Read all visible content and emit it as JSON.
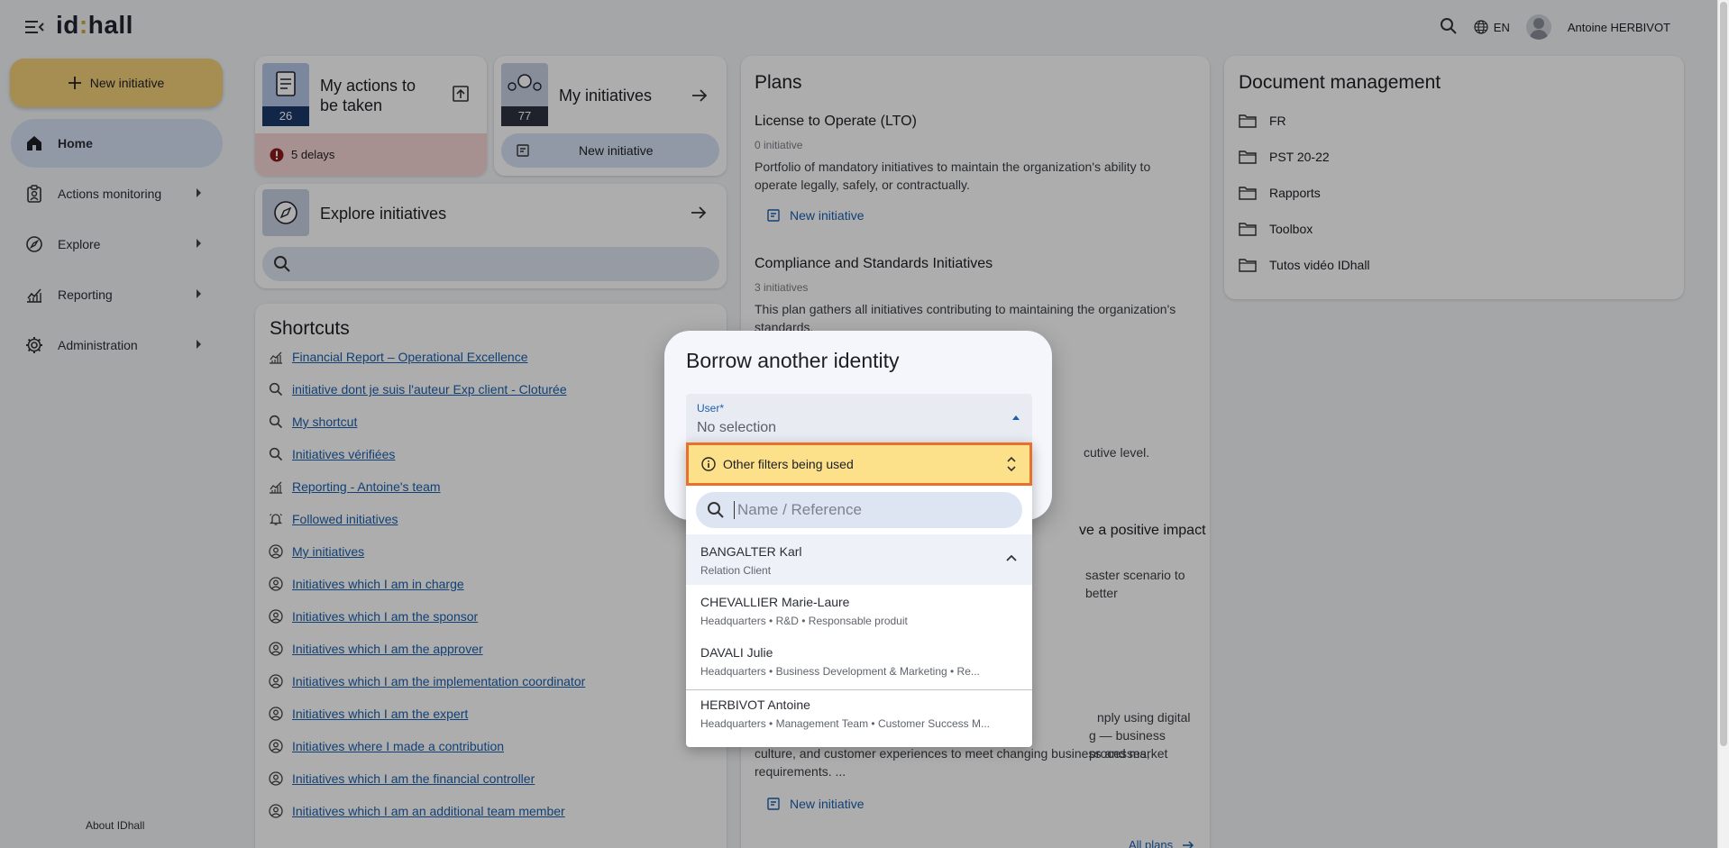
{
  "app": {
    "logo_text_1": "id",
    "logo_dot": ":",
    "logo_text_2": "hall",
    "language": "EN",
    "user_name": "Antoine HERBIVOT"
  },
  "sidebar": {
    "new_initiative_label": "New initiative",
    "items": [
      {
        "label": "Home",
        "icon": "home-icon",
        "active": true
      },
      {
        "label": "Actions monitoring",
        "icon": "clipboard-user-icon"
      },
      {
        "label": "Explore",
        "icon": "compass-icon"
      },
      {
        "label": "Reporting",
        "icon": "chart-icon"
      },
      {
        "label": "Administration",
        "icon": "gear-icon"
      }
    ],
    "about_label": "About IDhall"
  },
  "tiles": {
    "actions": {
      "title_line1": "My actions to",
      "title_line2": "be taken",
      "count": "26",
      "delays": "5 delays"
    },
    "initiatives": {
      "title": "My initiatives",
      "count": "77",
      "button": "New initiative"
    },
    "explore": {
      "title": "Explore initiatives"
    }
  },
  "shortcuts": {
    "title": "Shortcuts",
    "items": [
      {
        "label": "Financial Report – Operational Excellence",
        "icon": "chart-icon"
      },
      {
        "label": "initiative dont je suis l'auteur Exp client - Cloturée",
        "icon": "search-icon"
      },
      {
        "label": "My shortcut",
        "icon": "search-icon"
      },
      {
        "label": "Initiatives vérifiées",
        "icon": "search-icon"
      },
      {
        "label": "Reporting - Antoine's team",
        "icon": "chart-icon"
      },
      {
        "label": "Followed initiatives",
        "icon": "bell-icon"
      },
      {
        "label": "My initiatives",
        "icon": "user-circle-icon"
      },
      {
        "label": "Initiatives which I am in charge",
        "icon": "user-circle-icon"
      },
      {
        "label": "Initiatives which I am the sponsor",
        "icon": "user-circle-icon"
      },
      {
        "label": "Initiatives which I am the approver",
        "icon": "user-circle-icon"
      },
      {
        "label": "Initiatives which I am the implementation coordinator",
        "icon": "user-circle-icon"
      },
      {
        "label": "Initiatives which I am the expert",
        "icon": "user-circle-icon"
      },
      {
        "label": "Initiatives where I made a contribution",
        "icon": "user-circle-icon"
      },
      {
        "label": "Initiatives which I am the financial controller",
        "icon": "user-circle-icon"
      },
      {
        "label": "Initiatives which I am an additional team member",
        "icon": "user-circle-icon"
      }
    ]
  },
  "plans": {
    "title": "Plans",
    "p1": {
      "title": "License to Operate (LTO)",
      "count": "0 initiative",
      "desc": "Portfolio of mandatory initiatives to maintain the organization's ability to operate legally, safely, or contractually.",
      "link": "New initiative"
    },
    "p2": {
      "title": "Compliance and Standards Initiatives",
      "count": "3 initiatives",
      "desc": "This plan gathers all initiatives contributing to maintaining the organization's standards."
    },
    "p3_fragment": "cutive level.",
    "p4_title_fragment": "ve a positive impact",
    "p4_desc_fragment": "saster scenario to better",
    "p5": {
      "line1": "nply using digital",
      "line2": "g — business processes,",
      "line3": "culture, and customer experiences to meet changing business and market",
      "line4": "requirements. ...",
      "link": "New initiative"
    },
    "all_plans": "All plans"
  },
  "documents": {
    "title": "Document management",
    "folders": [
      "FR",
      "PST 20-22",
      "Rapports",
      "Toolbox",
      "Tutos vidéo IDhall"
    ]
  },
  "dialog": {
    "title": "Borrow another identity",
    "field_label": "User*",
    "field_value": "No selection"
  },
  "dropdown": {
    "filter_banner": "Other filters being used",
    "search_placeholder": "Name / Reference",
    "options": [
      {
        "name": "BANGALTER Karl",
        "sub": "Relation Client"
      },
      {
        "name": "CHEVALLIER Marie-Laure",
        "sub": "Headquarters • R&D • Responsable produit"
      },
      {
        "name": "DAVALI Julie",
        "sub": "Headquarters • Business Development & Marketing • Re..."
      },
      {
        "name": "HERBIVOT Antoine",
        "sub": "Headquarters • Management Team • Customer Success M..."
      }
    ]
  },
  "colors": {
    "accent": "#1a5fae",
    "primary_button": "#f5d27b",
    "filter_highlight": "#fde08a",
    "filter_border": "#e8702a",
    "delay_bg": "#f6d6d4"
  }
}
